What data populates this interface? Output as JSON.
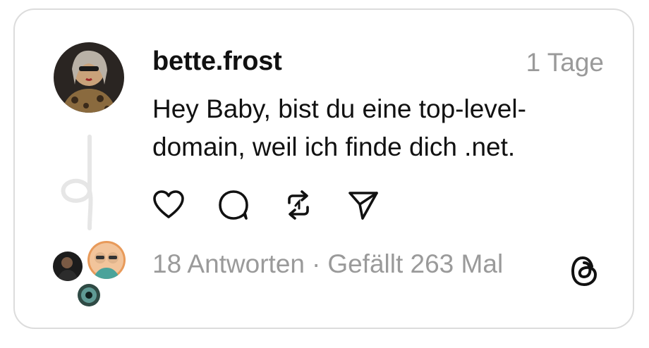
{
  "post": {
    "username": "bette.frost",
    "timestamp": "1 Tage",
    "text": "Hey Baby, bist du eine top-level-domain, weil ich finde dich .net.",
    "replies": "18 Antworten",
    "separator": "·",
    "likes": "Gefällt 263 Mal"
  },
  "actions": [
    {
      "name": "like",
      "icon": "heart-icon"
    },
    {
      "name": "reply",
      "icon": "comment-icon"
    },
    {
      "name": "repost",
      "icon": "repost-icon"
    },
    {
      "name": "share",
      "icon": "send-icon"
    }
  ],
  "colors": {
    "text": "#111111",
    "muted": "#9a9a9a",
    "border": "#dcdcdc",
    "thread_line": "#e6e6e6"
  }
}
